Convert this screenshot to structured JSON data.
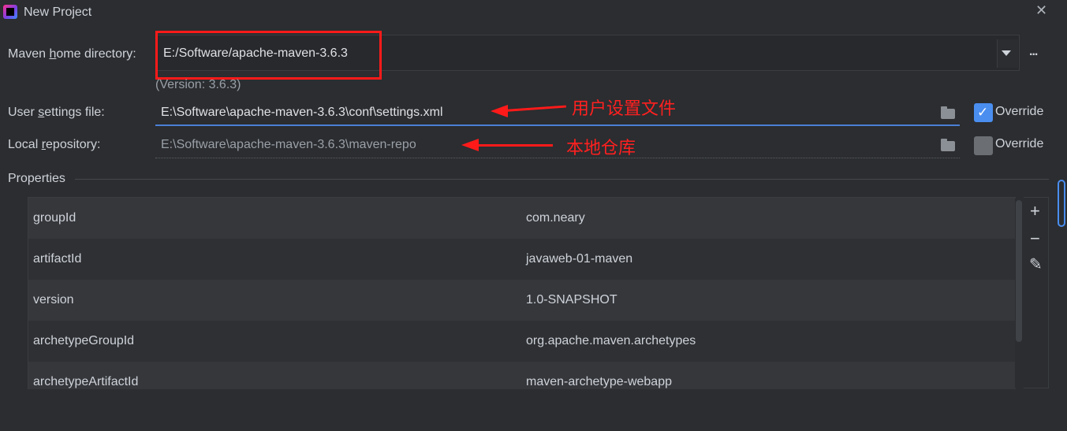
{
  "window": {
    "title": "New Project"
  },
  "maven_home": {
    "label_pre": "Maven ",
    "label_u": "h",
    "label_post": "ome directory:",
    "value": "E:/Software/apache-maven-3.6.3",
    "version": "(Version: 3.6.3)",
    "browse": "..."
  },
  "user_settings": {
    "label_pre": "User ",
    "label_u": "s",
    "label_post": "ettings file:",
    "value": "E:\\Software\\apache-maven-3.6.3\\conf\\settings.xml",
    "override_label": "Override",
    "override_checked": true,
    "annotation": "用户设置文件"
  },
  "local_repo": {
    "label_pre": "Local ",
    "label_u": "r",
    "label_post": "epository:",
    "value": "E:\\Software\\apache-maven-3.6.3\\maven-repo",
    "override_label": "Override",
    "override_checked": false,
    "annotation": "本地仓库"
  },
  "properties": {
    "title": "Properties",
    "rows": [
      {
        "key": "groupId",
        "value": "com.neary"
      },
      {
        "key": "artifactId",
        "value": "javaweb-01-maven"
      },
      {
        "key": "version",
        "value": "1.0-SNAPSHOT"
      },
      {
        "key": "archetypeGroupId",
        "value": "org.apache.maven.archetypes"
      },
      {
        "key": "archetypeArtifactId",
        "value": "maven-archetype-webapp"
      }
    ],
    "tools": {
      "add": "+",
      "remove": "−",
      "edit": "✎"
    }
  },
  "colors": {
    "accent": "#4a8ef0",
    "annotation": "#ff1a1a",
    "background": "#2b2d30"
  }
}
